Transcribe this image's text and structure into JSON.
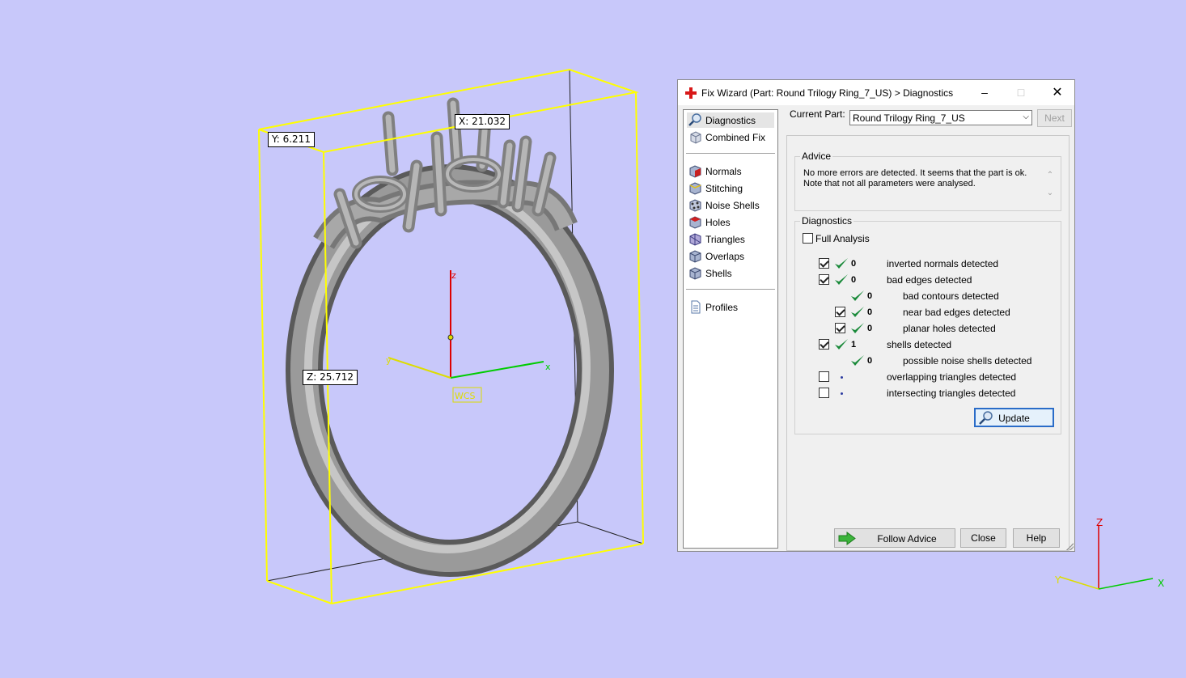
{
  "viewport": {
    "dimensions": {
      "x": "X: 21.032",
      "y": "Y: 6.211",
      "z": "Z: 25.712"
    },
    "wcs_label": "WCS",
    "axis_labels": {
      "x": "x",
      "y": "y",
      "z": "z"
    }
  },
  "triad": {
    "x": "X",
    "y": "Y",
    "z": "Z"
  },
  "dialog": {
    "title": "Fix Wizard (Part: Round Trilogy Ring_7_US) > Diagnostics",
    "nav": [
      {
        "label": "Diagnostics",
        "icon": "magnifier-icon",
        "selected": true
      },
      {
        "label": "Combined Fix",
        "icon": "cube-icon"
      },
      {
        "label": "Normals",
        "icon": "normals-cube-icon"
      },
      {
        "label": "Stitching",
        "icon": "stitching-cube-icon"
      },
      {
        "label": "Noise Shells",
        "icon": "noise-shells-icon"
      },
      {
        "label": "Holes",
        "icon": "holes-cube-icon"
      },
      {
        "label": "Triangles",
        "icon": "triangles-cube-icon"
      },
      {
        "label": "Overlaps",
        "icon": "overlaps-cube-icon"
      },
      {
        "label": "Shells",
        "icon": "shells-cube-icon"
      },
      {
        "label": "Profiles",
        "icon": "document-icon"
      }
    ],
    "current_part_label": "Current Part:",
    "current_part_value": "Round Trilogy Ring_7_US",
    "next_label": "Next",
    "advice_title": "Advice",
    "advice_line1": "No more errors are detected. It seems that the part is ok.",
    "advice_line2": "Note that not all parameters were analysed.",
    "diag_title": "Diagnostics",
    "full_analysis": "Full Analysis",
    "rows": [
      {
        "checked": true,
        "status": "ok",
        "count": "0",
        "text": "inverted normals detected"
      },
      {
        "checked": true,
        "status": "ok",
        "count": "0",
        "text": "bad edges detected"
      },
      {
        "checked": null,
        "status": "ok",
        "count": "0",
        "text": "bad contours detected"
      },
      {
        "checked": true,
        "status": "ok",
        "count": "0",
        "text": "near bad edges detected"
      },
      {
        "checked": true,
        "status": "ok",
        "count": "0",
        "text": "planar holes detected"
      },
      {
        "checked": true,
        "status": "ok",
        "count": "1",
        "text": "shells detected"
      },
      {
        "checked": null,
        "status": "ok",
        "count": "0",
        "text": "possible noise shells detected"
      },
      {
        "checked": false,
        "status": "pending",
        "count": "",
        "text": "overlapping triangles detected"
      },
      {
        "checked": false,
        "status": "pending",
        "count": "",
        "text": "intersecting triangles detected"
      }
    ],
    "update_label": "Update",
    "follow_advice_label": "Follow Advice",
    "close_label": "Close",
    "help_label": "Help"
  }
}
